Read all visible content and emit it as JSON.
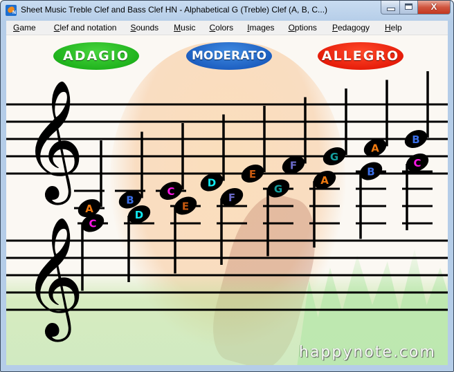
{
  "window": {
    "title": "Sheet Music Treble Clef and Bass Clef HN - Alphabetical G (Treble) Clef (A, B, C...)",
    "app_icon_label": "N",
    "close_glyph": "X"
  },
  "menu": [
    {
      "label": "Game",
      "accel": "G",
      "rest": "ame"
    },
    {
      "label": "Clef and notation",
      "accel": "C",
      "rest": "lef and notation"
    },
    {
      "label": "Sounds",
      "accel": "S",
      "rest": "ounds"
    },
    {
      "label": "Music",
      "accel": "M",
      "rest": "usic"
    },
    {
      "label": "Colors",
      "accel": "C",
      "rest": "olors"
    },
    {
      "label": "Images",
      "accel": "I",
      "rest": "mages"
    },
    {
      "label": "Options",
      "accel": "O",
      "rest": "ptions"
    },
    {
      "label": "Pedagogy",
      "accel": "P",
      "rest": "edagogy"
    },
    {
      "label": "Help",
      "accel": "H",
      "rest": "elp"
    }
  ],
  "tempo_buttons": [
    {
      "id": "adagio",
      "label": "ADAGIO",
      "color": "#20b31d"
    },
    {
      "id": "moderato",
      "label": "MODERATO",
      "color": "#1d5fc1"
    },
    {
      "id": "allegro",
      "label": "ALLEGRO",
      "color": "#e61d0a"
    }
  ],
  "note_colors": {
    "A": "#f07a10",
    "B": "#3a6fe8",
    "C": "#ff16e8",
    "D": "#10e8f0",
    "E": "#c85a10",
    "F": "#6a6ac8",
    "G": "#139e9e"
  },
  "staves": [
    {
      "id": "top-staff",
      "clef": "treble",
      "notes": [
        "A",
        "B",
        "C",
        "D",
        "E",
        "F",
        "G",
        "A",
        "B"
      ],
      "pitches": [
        "A3",
        "B3",
        "C4",
        "D4",
        "E4",
        "F4",
        "G4",
        "A4",
        "B4"
      ]
    },
    {
      "id": "bottom-staff",
      "clef": "treble",
      "notes": [
        "C",
        "D",
        "E",
        "F",
        "G",
        "A",
        "B",
        "C"
      ],
      "pitches": [
        "C5",
        "D5",
        "E5",
        "F5",
        "G5",
        "A5",
        "B5",
        "C6"
      ]
    }
  ],
  "watermark": "happynote.com"
}
